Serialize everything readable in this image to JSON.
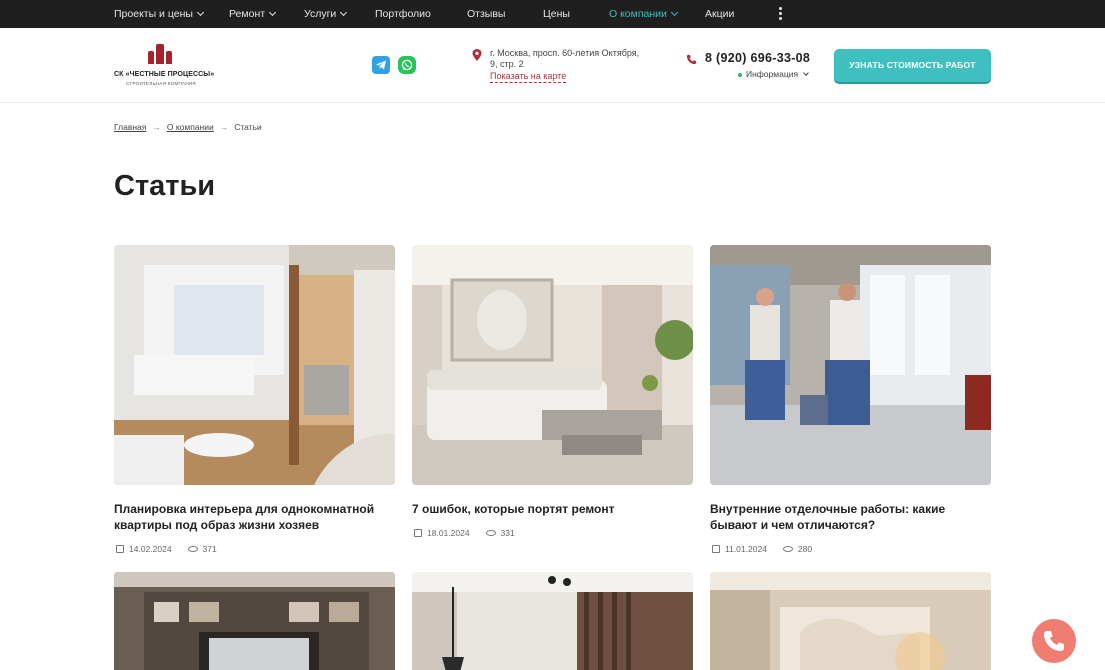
{
  "topnav": {
    "items": [
      {
        "label": "Проекты и цены",
        "dropdown": true
      },
      {
        "label": "Ремонт",
        "dropdown": true
      },
      {
        "label": "Услуги",
        "dropdown": true
      },
      {
        "label": "Портфолио",
        "dropdown": false
      },
      {
        "label": "Отзывы",
        "dropdown": false
      },
      {
        "label": "Цены",
        "dropdown": false
      },
      {
        "label": "О компании",
        "dropdown": true,
        "active": true
      },
      {
        "label": "Акции",
        "dropdown": false
      }
    ],
    "more_icon": "kebab-menu-icon"
  },
  "header": {
    "logo_name": "СК «ЧЕСТНЫЕ ПРОЦЕССЫ»",
    "logo_sub": "СТРОИТЕЛЬНАЯ КОМПАНИЯ",
    "address_line1": "г. Москва, просп. 60-летия Октября,",
    "address_line2": "9, стр. 2",
    "map_link": "Показать на карте",
    "phone": "8 (920) 696-33-08",
    "info_label": "Информация",
    "cta_label": "УЗНАТЬ СТОИМОСТЬ РАБОТ"
  },
  "breadcrumb": {
    "items": [
      "Главная",
      "О компании",
      "Статьи"
    ]
  },
  "page_title": "Статьи",
  "articles": [
    {
      "title": "Планировка интерьера для однокомнатной квартиры под образ жизни хозяев",
      "date": "14.02.2024",
      "views": "371"
    },
    {
      "title": "7 ошибок, которые портят ремонт",
      "date": "18.01.2024",
      "views": "331"
    },
    {
      "title": "Внутренние отделочные работы: какие бывают и чем отличаются?",
      "date": "11.01.2024",
      "views": "280"
    }
  ],
  "colors": {
    "accent": "#3fbfbf",
    "brand": "#a3242c",
    "topbar": "#1f1f1f",
    "call_button": "#ef7d72"
  }
}
